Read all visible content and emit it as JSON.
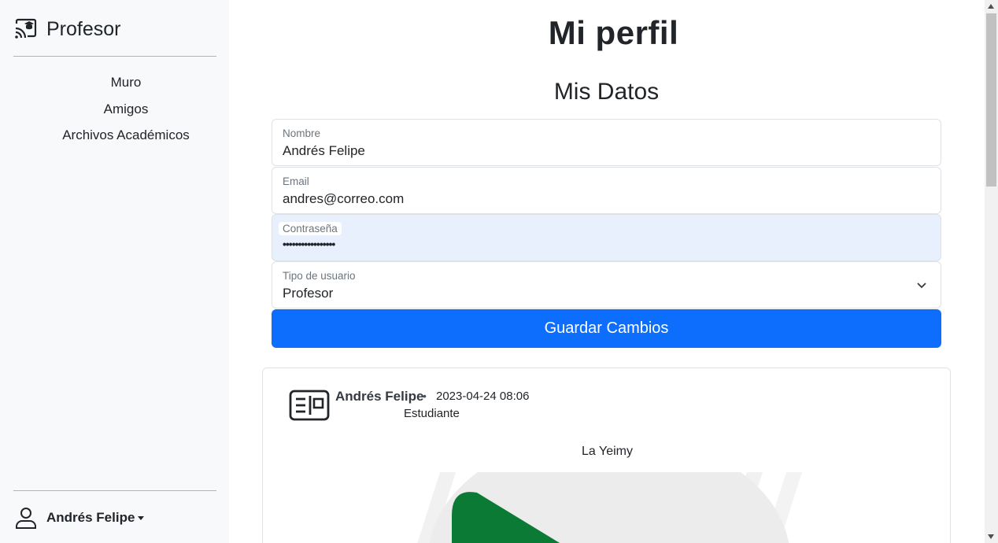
{
  "sidebar": {
    "brand": "Profesor",
    "brand_icon": "cast-icon",
    "nav": [
      {
        "label": "Muro"
      },
      {
        "label": "Amigos"
      },
      {
        "label": "Archivos Académicos"
      }
    ],
    "user": {
      "name": "Andrés Felipe",
      "icon": "person-icon"
    }
  },
  "main": {
    "title": "Mi perfil",
    "section": "Mis Datos",
    "form": {
      "name_label": "Nombre",
      "name_value": "Andrés Felipe",
      "email_label": "Email",
      "email_value": "andres@correo.com",
      "password_label": "Contraseña",
      "password_value": "•••••••••••••••••",
      "type_label": "Tipo de usuario",
      "type_value": "Profesor"
    },
    "save_button": "Guardar Cambios"
  },
  "post": {
    "author": "Andrés Felipe",
    "separator": "•",
    "date": "2023-04-24 08:06",
    "role": "Estudiante",
    "text": "La Yeimy",
    "author_icon": "id-card-icon"
  },
  "colors": {
    "primary": "#0d6efd",
    "sidebar_bg": "#f8f9fa",
    "autofill_bg": "#e8f0fe",
    "image_green": "#0a7a35"
  }
}
